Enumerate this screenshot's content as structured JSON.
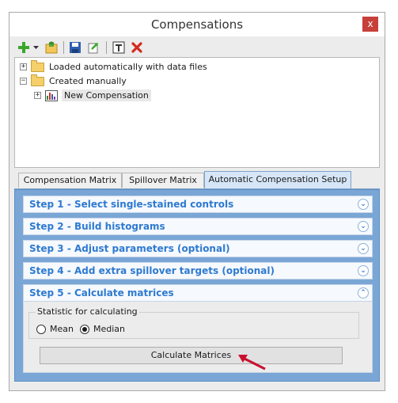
{
  "window": {
    "title": "Compensations",
    "close_glyph": "x"
  },
  "toolbar": {
    "icons": [
      "add-icon",
      "dropdown-arrow-icon",
      "open-folder-icon",
      "save-icon",
      "export-icon",
      "text-tool-icon",
      "delete-icon"
    ]
  },
  "tree": {
    "items": [
      {
        "label": "Loaded automatically with data files",
        "expander": "+"
      },
      {
        "label": "Created manually",
        "expander": "−"
      },
      {
        "label": "New Compensation",
        "expander": "+"
      }
    ]
  },
  "tabs": [
    {
      "label": "Compensation Matrix"
    },
    {
      "label": "Spillover Matrix"
    },
    {
      "label": "Automatic Compensation Setup",
      "active": true
    }
  ],
  "steps": [
    {
      "label": "Step 1 - Select single-stained controls",
      "chevron": "⌄"
    },
    {
      "label": "Step 2 - Build histograms",
      "chevron": "⌄"
    },
    {
      "label": "Step 3 - Adjust parameters (optional)",
      "chevron": "⌄"
    },
    {
      "label": "Step 4 - Add extra spillover targets (optional)",
      "chevron": "⌄"
    },
    {
      "label": "Step 5 - Calculate matrices",
      "chevron": "⌃"
    }
  ],
  "statistic": {
    "group_label": "Statistic for calculating",
    "options": [
      {
        "label": "Mean",
        "selected": false
      },
      {
        "label": "Median",
        "selected": true
      }
    ]
  },
  "calculate_button": {
    "label": "Calculate Matrices"
  },
  "colors": {
    "accent": "#2e7ad1",
    "panel": "#7aa6d6",
    "close": "#c7403a",
    "arrow": "#c8102e"
  }
}
